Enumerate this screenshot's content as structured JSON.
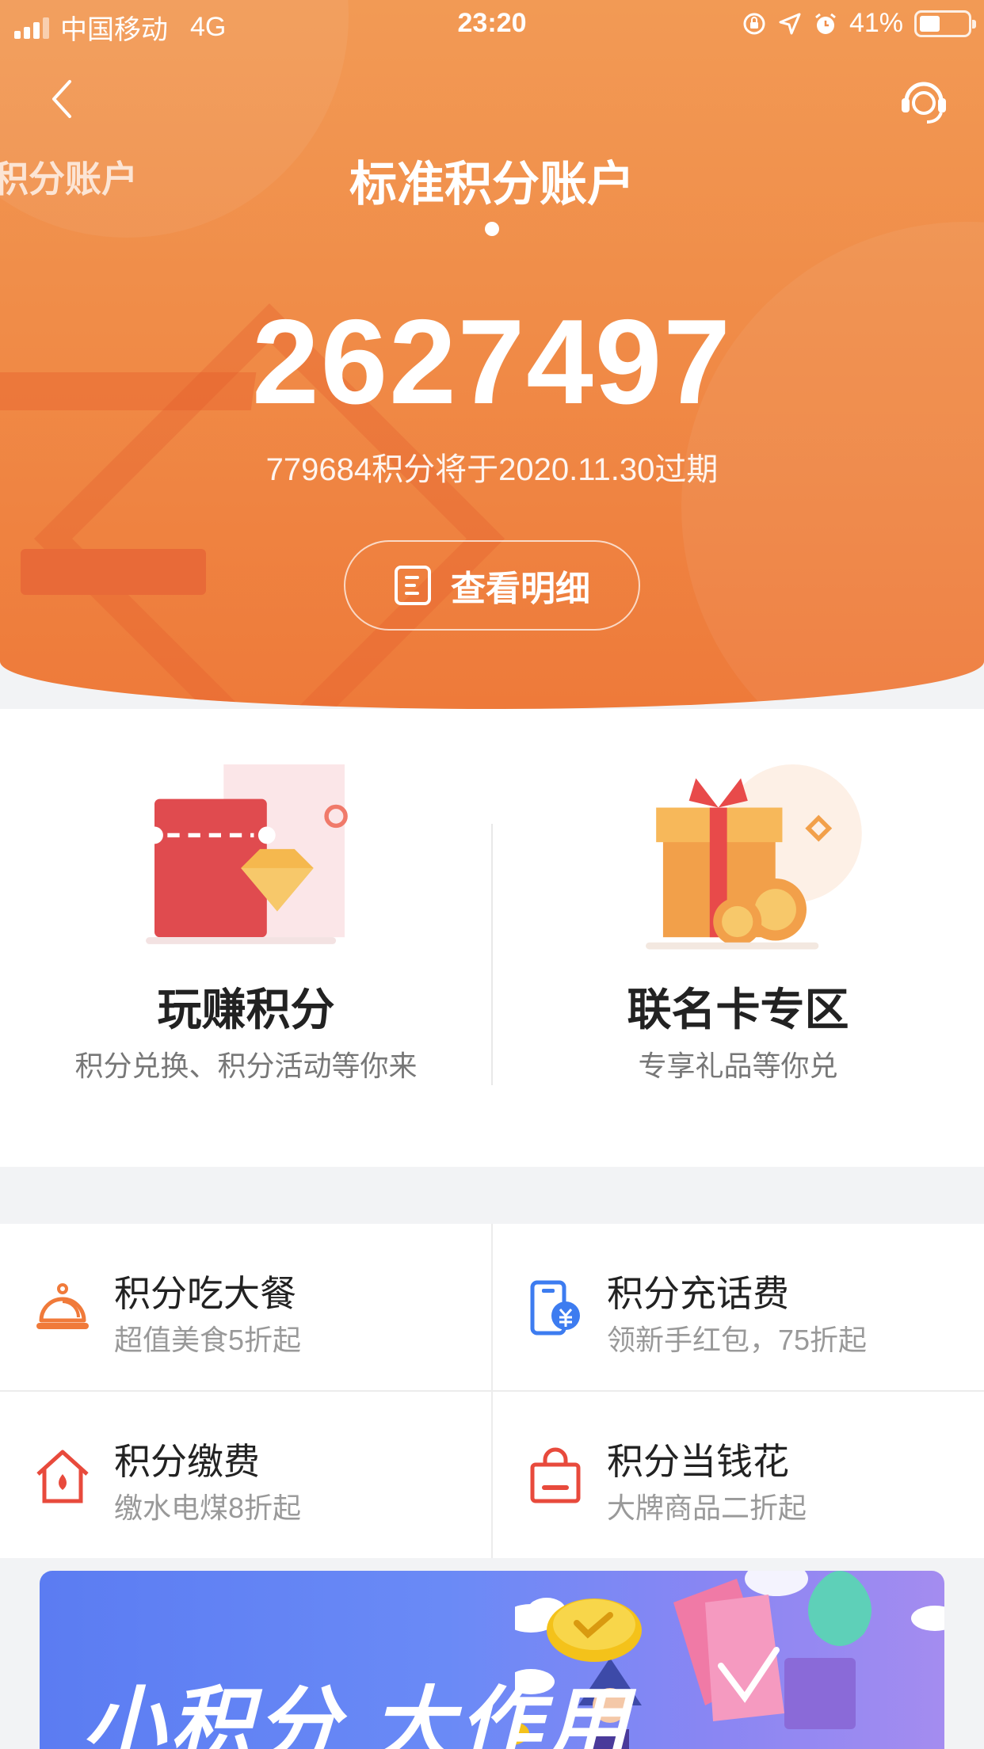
{
  "status_bar": {
    "carrier": "中国移动",
    "network": "4G",
    "time": "23:20",
    "battery": "41%",
    "battery_level": 0.41
  },
  "header": {
    "side_tab": "积分账户",
    "title": "标准积分账户"
  },
  "account": {
    "points": "2627497",
    "expire_note": "779684积分将于2020.11.30过期",
    "detail_button": "查看明细"
  },
  "features": [
    {
      "title": "玩赚积分",
      "subtitle": "积分兑换、积分活动等你来",
      "icon": "ticket-diamond-icon"
    },
    {
      "title": "联名卡专区",
      "subtitle": "专享礼品等你兑",
      "icon": "gift-box-icon"
    }
  ],
  "services": [
    {
      "name": "积分吃大餐",
      "desc": "超值美食5折起",
      "icon": "dining-bell-icon",
      "color": "#f07a3a"
    },
    {
      "name": "积分充话费",
      "desc": "领新手红包，75折起",
      "icon": "phone-recharge-icon",
      "color": "#3d7cf0"
    },
    {
      "name": "积分缴费",
      "desc": "缴水电煤8折起",
      "icon": "home-bill-icon",
      "color": "#e84a3c"
    },
    {
      "name": "积分当钱花",
      "desc": "大牌商品二折起",
      "icon": "shopping-bag-icon",
      "color": "#e84a3c"
    }
  ],
  "banner": {
    "slogan": "小积分 大作用"
  },
  "colors": {
    "hero_orange": "#f08c48",
    "accent_red": "#e84a3c",
    "accent_blue": "#3d7cf0",
    "banner_blue": "#5b7cf2"
  }
}
